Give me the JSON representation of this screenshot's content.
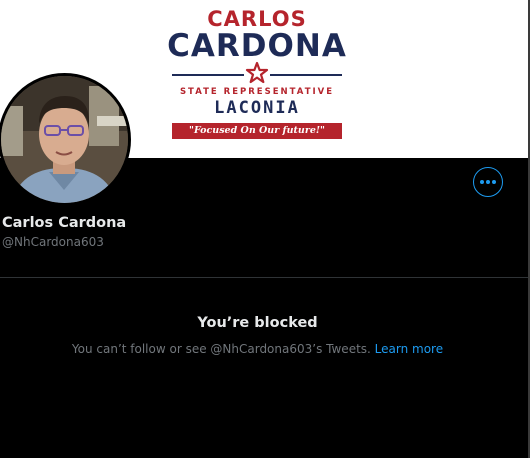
{
  "banner": {
    "first_name": "CARLOS",
    "last_name": "CARDONA",
    "office": "STATE REPRESENTATIVE",
    "town": "LACONIA",
    "slogan": "\"Focused On Our future!\""
  },
  "profile": {
    "display_name": "Carlos Cardona",
    "handle": "@NhCardona603"
  },
  "blocked": {
    "title": "You’re blocked",
    "message": "You can’t follow or see @NhCardona603’s Tweets.",
    "learn_more": "Learn more"
  },
  "icons": {
    "more": "more-horizontal-icon",
    "star": "star-icon"
  },
  "colors": {
    "accent": "#1d9bf0",
    "logo_red": "#b5242c",
    "logo_navy": "#1e2b57",
    "background": "#000000"
  }
}
